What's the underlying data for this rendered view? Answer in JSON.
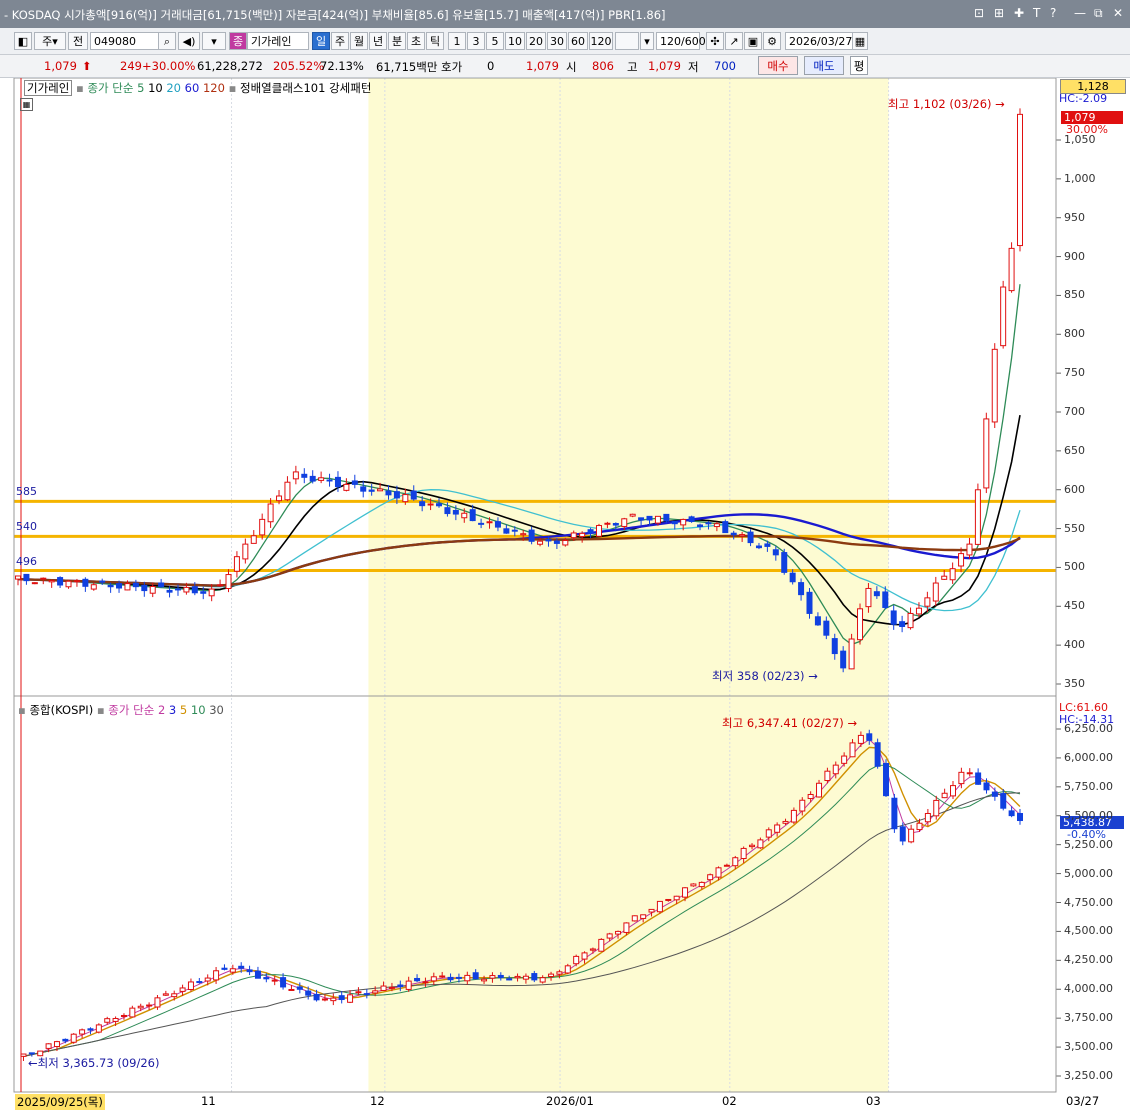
{
  "window": {
    "title": "- KOSDAQ 시가총액[916(억)] 거래대금[61,715(백만)] 자본금[424(억)] 부채비율[85.6] 유보율[15.7] 매출액[417(억)] PBR[1.86]",
    "controls": [
      "⊡",
      "⊞",
      "✚",
      "T",
      "?",
      "—",
      "⧉",
      "✕"
    ]
  },
  "toolbar": {
    "type": "주",
    "prefix": "전",
    "code": "049080",
    "chart_type": "기가레인",
    "periods": [
      "일",
      "주",
      "월",
      "년",
      "분",
      "초",
      "틱"
    ],
    "numbers": [
      "1",
      "3",
      "5",
      "10",
      "20",
      "30",
      "60",
      "120"
    ],
    "count": "120/600",
    "date": "2026/03/27"
  },
  "quote": {
    "price": "1,079",
    "change": "249",
    "change_pct": "+30.00%",
    "volume": "61,228,272",
    "vol_ratio": "205.52%",
    "turnover": "72.13%",
    "amount": "61,715백만",
    "bid_label": "호가",
    "bid": "0",
    "bid_price": "1,079",
    "open_label": "시",
    "open": "806",
    "high_label": "고",
    "high": "1,079",
    "low_label": "저",
    "low": "700",
    "buy": "매수",
    "sell": "매도",
    "avg": "평"
  },
  "upper": {
    "name": "기가레인",
    "ma_label": "종가 단순",
    "ma": [
      "5",
      "10",
      "20",
      "60",
      "120"
    ],
    "pattern": "정배열클래스101 강세패턴",
    "high_ann": "최고 1,102 (03/26)",
    "low_ann": "최저 358 (02/23)",
    "top_badge": "1,128",
    "hc": "HC:-2.09",
    "price_badge": "1,079",
    "pct_badge": "30.00%",
    "hlines": [
      {
        "label": "585",
        "v": 585
      },
      {
        "label": "540",
        "v": 540
      },
      {
        "label": "496",
        "v": 496
      }
    ],
    "yticks": [
      {
        "v": 1050,
        "t": "1,050"
      },
      {
        "v": 1000,
        "t": "1,000"
      },
      {
        "v": 950,
        "t": "950"
      },
      {
        "v": 900,
        "t": "900"
      },
      {
        "v": 850,
        "t": "850"
      },
      {
        "v": 800,
        "t": "800"
      },
      {
        "v": 750,
        "t": "750"
      },
      {
        "v": 700,
        "t": "700"
      },
      {
        "v": 650,
        "t": "650"
      },
      {
        "v": 600,
        "t": "600"
      },
      {
        "v": 550,
        "t": "550"
      },
      {
        "v": 500,
        "t": "500"
      },
      {
        "v": 450,
        "t": "450"
      },
      {
        "v": 400,
        "t": "400"
      },
      {
        "v": 350,
        "t": "350"
      }
    ]
  },
  "lower": {
    "name": "종합(KOSPI)",
    "ma_label": "종가 단순",
    "ma": [
      "2",
      "3",
      "5",
      "10",
      "30"
    ],
    "high_ann": "최고 6,347.41 (02/27)",
    "low_ann": "최저 3,365.73 (09/26)",
    "lc": "LC:61.60",
    "hc": "HC:-14.31",
    "price_badge": "5,438.87",
    "pct_badge": "-0.40%",
    "yticks": [
      {
        "v": 6250,
        "t": "6,250.00"
      },
      {
        "v": 6000,
        "t": "6,000.00"
      },
      {
        "v": 5750,
        "t": "5,750.00"
      },
      {
        "v": 5500,
        "t": "5,500.00"
      },
      {
        "v": 5250,
        "t": "5,250.00"
      },
      {
        "v": 5000,
        "t": "5,000.00"
      },
      {
        "v": 4750,
        "t": "4,750.00"
      },
      {
        "v": 4500,
        "t": "4,500.00"
      },
      {
        "v": 4250,
        "t": "4,250.00"
      },
      {
        "v": 4000,
        "t": "4,000.00"
      },
      {
        "v": 3750,
        "t": "3,750.00"
      },
      {
        "v": 3500,
        "t": "3,500.00"
      },
      {
        "v": 3250,
        "t": "3,250.00"
      }
    ]
  },
  "xaxis": {
    "start": "2025/09/25(목)",
    "labels": [
      "11",
      "12",
      "2026/01",
      "02",
      "03"
    ],
    "end": "03/27"
  },
  "colors": {
    "up": "#e01010",
    "down": "#1040e0",
    "ma5": "#2e8b57",
    "ma10": "#000000",
    "ma20": "#40c0d0",
    "ma60": "#1a1ad0",
    "ma120": "#8b3a10",
    "band": "#fdfbd2",
    "hline": "#f5b400"
  },
  "chart_data": [
    {
      "type": "candlestick",
      "title": "기가레인",
      "x_range": [
        "2025/09/25",
        "2026/03/27"
      ],
      "ylim": [
        340,
        1130
      ],
      "series": [
        {
          "name": "종가",
          "points": [
            [
              "2025/09/25",
              485
            ],
            [
              "2025/10/31",
              468
            ],
            [
              "2025/11/14",
              620
            ],
            [
              "2025/12/05",
              590
            ],
            [
              "2025/12/31",
              530
            ],
            [
              "2026/01/15",
              565
            ],
            [
              "2026/01/30",
              555
            ],
            [
              "2026/02/10",
              520
            ],
            [
              "2026/02/23",
              370
            ],
            [
              "2026/02/27",
              480
            ],
            [
              "2026/03/05",
              420
            ],
            [
              "2026/03/18",
              530
            ],
            [
              "2026/03/24",
              868
            ],
            [
              "2026/03/25",
              1000
            ],
            [
              "2026/03/26",
              810
            ],
            [
              "2026/03/27",
              1079
            ]
          ]
        }
      ],
      "key_levels": [
        585,
        540,
        496
      ]
    },
    {
      "type": "candlestick",
      "title": "종합(KOSPI)",
      "x_range": [
        "2025/09/25",
        "2026/03/27"
      ],
      "ylim": [
        3200,
        6400
      ],
      "series": [
        {
          "name": "종가",
          "points": [
            [
              "2025/09/26",
              3420
            ],
            [
              "2025/10/15",
              3800
            ],
            [
              "2025/11/03",
              4200
            ],
            [
              "2025/11/20",
              3900
            ],
            [
              "2025/12/10",
              4100
            ],
            [
              "2025/12/31",
              4100
            ],
            [
              "2026/01/15",
              4600
            ],
            [
              "2026/01/30",
              5000
            ],
            [
              "2026/02/13",
              5500
            ],
            [
              "2026/02/27",
              6250
            ],
            [
              "2026/03/05",
              5250
            ],
            [
              "2026/03/17",
              5900
            ],
            [
              "2026/03/27",
              5438.87
            ]
          ]
        }
      ]
    }
  ]
}
